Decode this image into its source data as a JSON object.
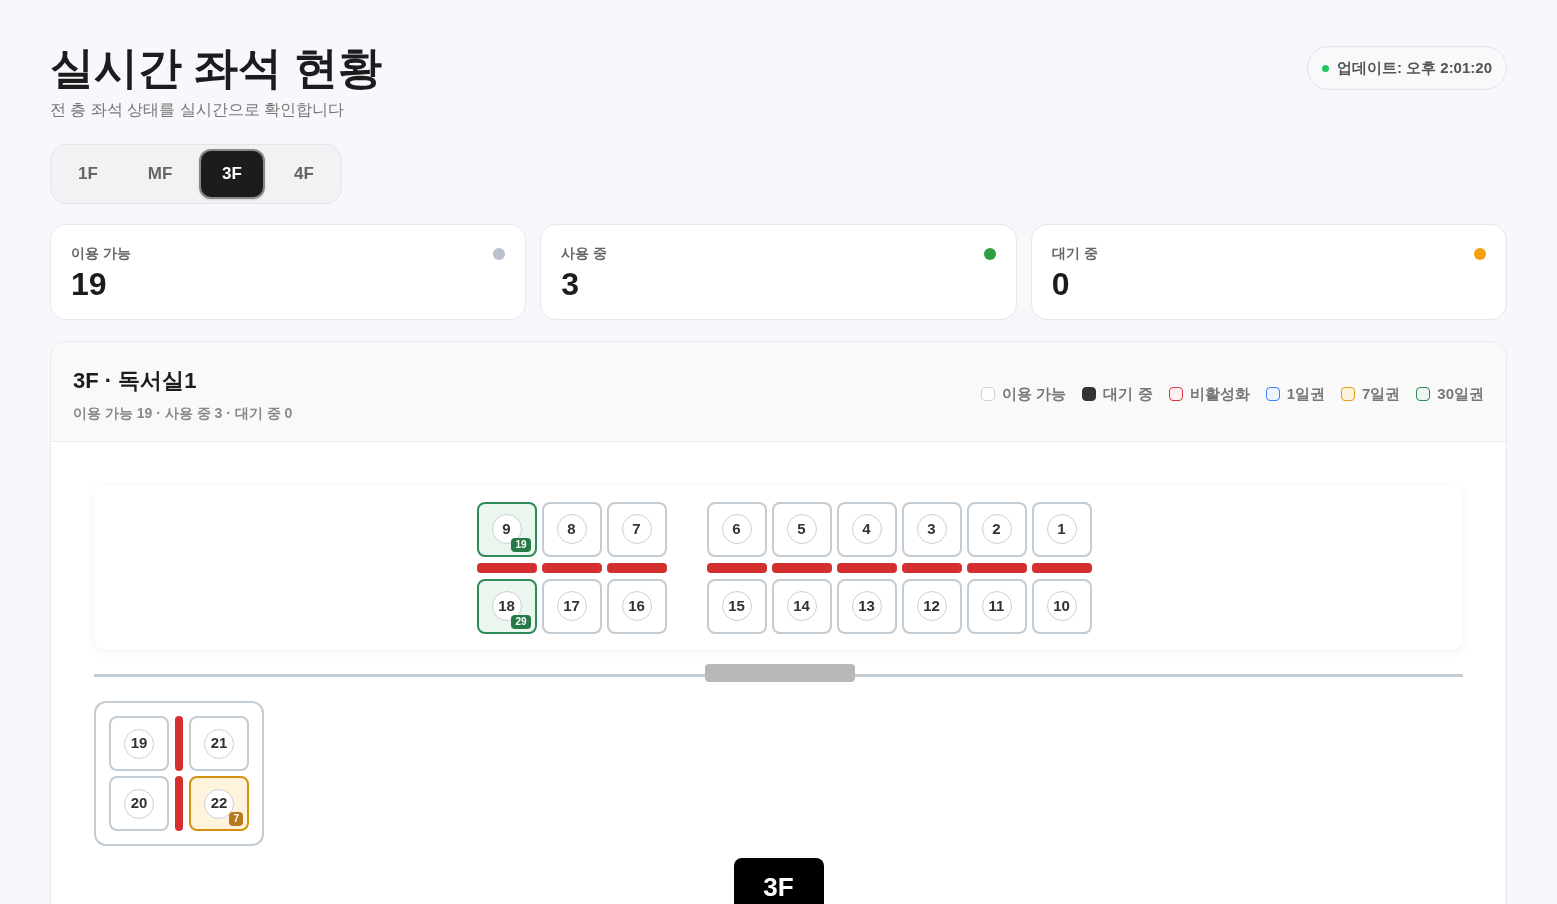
{
  "title": "실시간 좌석 현황",
  "subtitle": "전 층 좌석 상태를 실시간으로 확인합니다",
  "update": {
    "label": "업데이트: 오후 2:01:20",
    "color": "#22c55e"
  },
  "floor_tabs": [
    {
      "label": "1F",
      "selected": false
    },
    {
      "label": "MF",
      "selected": false
    },
    {
      "label": "3F",
      "selected": true
    },
    {
      "label": "4F",
      "selected": false
    }
  ],
  "stats": [
    {
      "label": "이용 가능",
      "value": "19",
      "color": "#b8c1cc"
    },
    {
      "label": "사용 중",
      "value": "3",
      "color": "#2ea043"
    },
    {
      "label": "대기 중",
      "value": "0",
      "color": "#f59e0b"
    }
  ],
  "room": {
    "title": "3F · 독서실1",
    "summary": "이용 가능 19 · 사용 중 3 · 대기 중 0",
    "legend": [
      {
        "kind": "available",
        "label": "이용 가능"
      },
      {
        "kind": "waiting",
        "label": "대기 중"
      },
      {
        "kind": "disabled",
        "label": "비활성화"
      },
      {
        "kind": "pass1",
        "label": "1일권"
      },
      {
        "kind": "pass7",
        "label": "7일권"
      },
      {
        "kind": "pass30",
        "label": "30일권"
      }
    ],
    "block_top": [
      [
        {
          "number": "9",
          "kind": "pass30",
          "badge": "19"
        },
        {
          "number": "8",
          "kind": "available"
        },
        {
          "number": "7",
          "kind": "available"
        }
      ],
      [
        {
          "number": "6",
          "kind": "available"
        },
        {
          "number": "5",
          "kind": "available"
        },
        {
          "number": "4",
          "kind": "available"
        },
        {
          "number": "3",
          "kind": "available"
        },
        {
          "number": "2",
          "kind": "available"
        },
        {
          "number": "1",
          "kind": "available"
        }
      ]
    ],
    "block_bottom": [
      [
        {
          "number": "18",
          "kind": "pass30",
          "badge": "29"
        },
        {
          "number": "17",
          "kind": "available"
        },
        {
          "number": "16",
          "kind": "available"
        }
      ],
      [
        {
          "number": "15",
          "kind": "available"
        },
        {
          "number": "14",
          "kind": "available"
        },
        {
          "number": "13",
          "kind": "available"
        },
        {
          "number": "12",
          "kind": "available"
        },
        {
          "number": "11",
          "kind": "available"
        },
        {
          "number": "10",
          "kind": "available"
        }
      ]
    ],
    "cluster": [
      [
        {
          "number": "19",
          "kind": "available"
        },
        {
          "number": "21",
          "kind": "available"
        }
      ],
      [
        {
          "number": "20",
          "kind": "available"
        },
        {
          "number": "22",
          "kind": "pass7",
          "badge": "7"
        }
      ]
    ],
    "floor_label": "3F"
  }
}
